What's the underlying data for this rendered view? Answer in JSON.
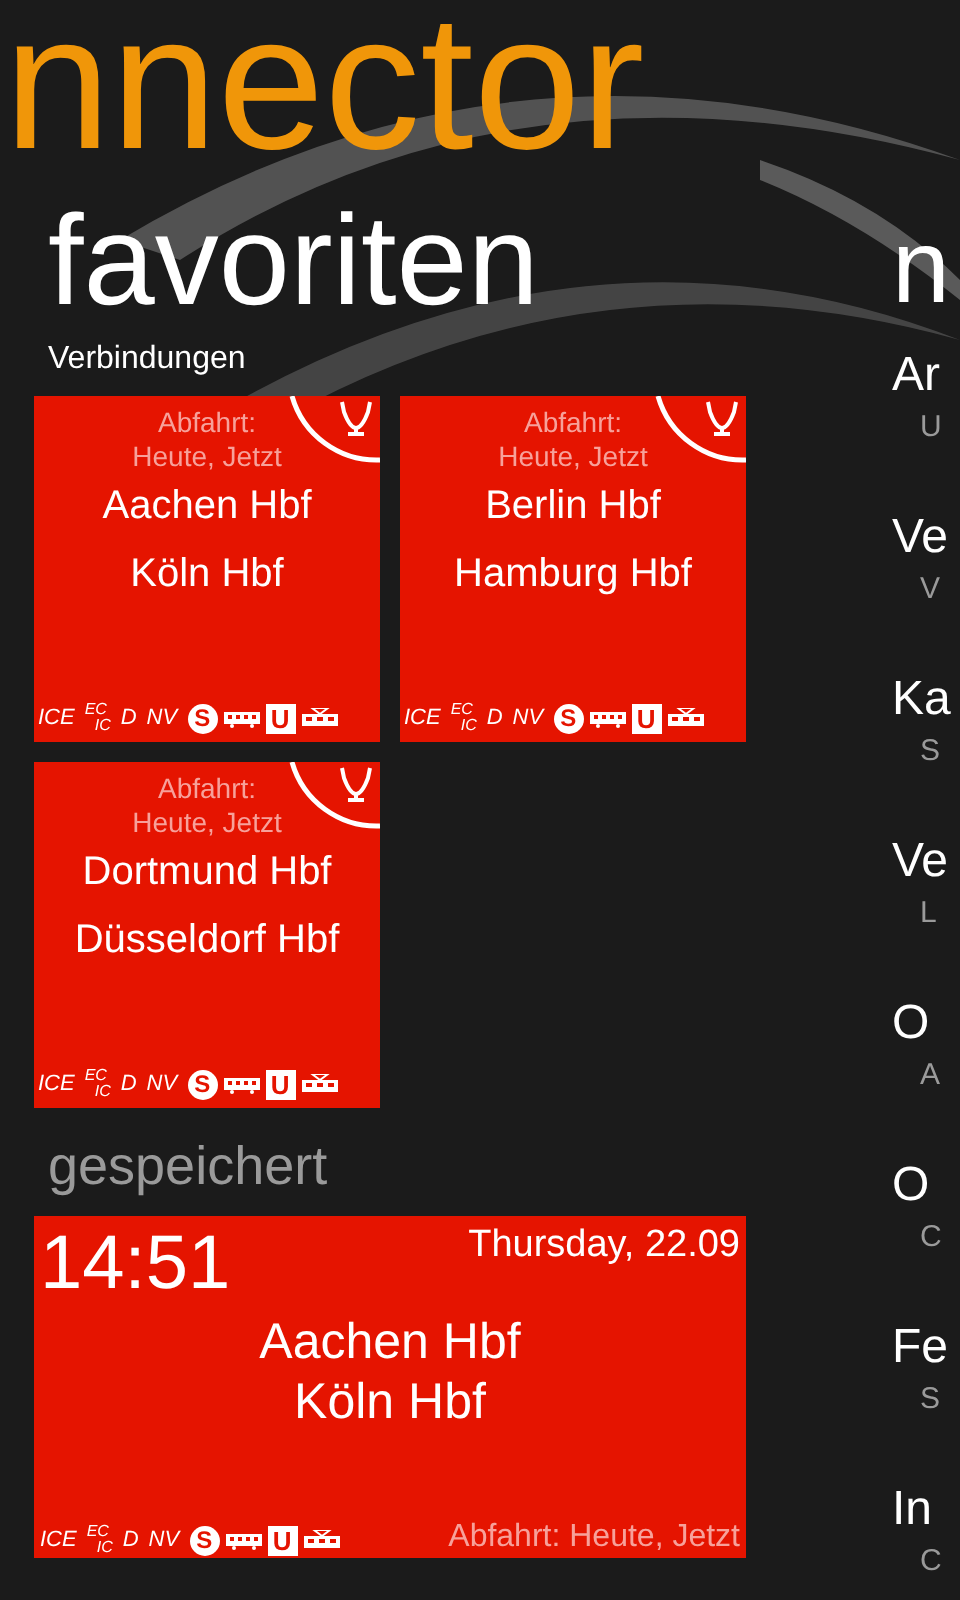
{
  "app_title": "nnector",
  "favorites": {
    "title": "favoriten",
    "section": "Verbindungen",
    "tiles": [
      {
        "departure_label": "Abfahrt:",
        "departure_time": "Heute, Jetzt",
        "from": "Aachen Hbf",
        "to": "Köln Hbf",
        "products": [
          {
            "kind": "text",
            "label": "ICE"
          },
          {
            "kind": "stack",
            "top": "EC",
            "bottom": "IC"
          },
          {
            "kind": "text",
            "label": "D"
          },
          {
            "kind": "text",
            "label": "NV"
          },
          {
            "kind": "circle",
            "label": "S"
          },
          {
            "kind": "bus"
          },
          {
            "kind": "square",
            "label": "U"
          },
          {
            "kind": "tram"
          }
        ]
      },
      {
        "departure_label": "Abfahrt:",
        "departure_time": "Heute, Jetzt",
        "from": "Berlin Hbf",
        "to": "Hamburg Hbf",
        "products": [
          {
            "kind": "text",
            "label": "ICE"
          },
          {
            "kind": "stack",
            "top": "EC",
            "bottom": "IC"
          },
          {
            "kind": "text",
            "label": "D"
          },
          {
            "kind": "text",
            "label": "NV"
          },
          {
            "kind": "circle",
            "label": "S"
          },
          {
            "kind": "bus"
          },
          {
            "kind": "square",
            "label": "U"
          },
          {
            "kind": "tram"
          }
        ]
      },
      {
        "departure_label": "Abfahrt:",
        "departure_time": "Heute, Jetzt",
        "from": "Dortmund Hbf",
        "to": "Düsseldorf Hbf",
        "products": [
          {
            "kind": "text",
            "label": "ICE"
          },
          {
            "kind": "stack",
            "top": "EC",
            "bottom": "IC"
          },
          {
            "kind": "text",
            "label": "D"
          },
          {
            "kind": "text",
            "label": "NV"
          },
          {
            "kind": "circle",
            "label": "S"
          },
          {
            "kind": "bus"
          },
          {
            "kind": "square",
            "label": "U"
          },
          {
            "kind": "tram"
          }
        ]
      }
    ]
  },
  "saved": {
    "title": "gespeichert",
    "tile": {
      "time": "14:51",
      "date": "Thursday, 22.09",
      "from": "Aachen Hbf",
      "to": "Köln Hbf",
      "departure": "Abfahrt: Heute, Jetzt",
      "products": [
        {
          "kind": "text",
          "label": "ICE"
        },
        {
          "kind": "stack",
          "top": "EC",
          "bottom": "IC"
        },
        {
          "kind": "text",
          "label": "D"
        },
        {
          "kind": "text",
          "label": "NV"
        },
        {
          "kind": "circle",
          "label": "S"
        },
        {
          "kind": "bus"
        },
        {
          "kind": "square",
          "label": "U"
        },
        {
          "kind": "tram"
        }
      ]
    }
  },
  "next_panel": {
    "title": "n",
    "items": [
      {
        "title": "Ar",
        "subtitle": "U"
      },
      {
        "title": "Ve",
        "subtitle": "V"
      },
      {
        "title": "Ka",
        "subtitle": "S"
      },
      {
        "title": "Ve",
        "subtitle": "L"
      },
      {
        "title": "O",
        "subtitle": "A"
      },
      {
        "title": "O",
        "subtitle": "C"
      },
      {
        "title": "Fe",
        "subtitle": "S"
      },
      {
        "title": "In",
        "subtitle": "C"
      }
    ]
  }
}
